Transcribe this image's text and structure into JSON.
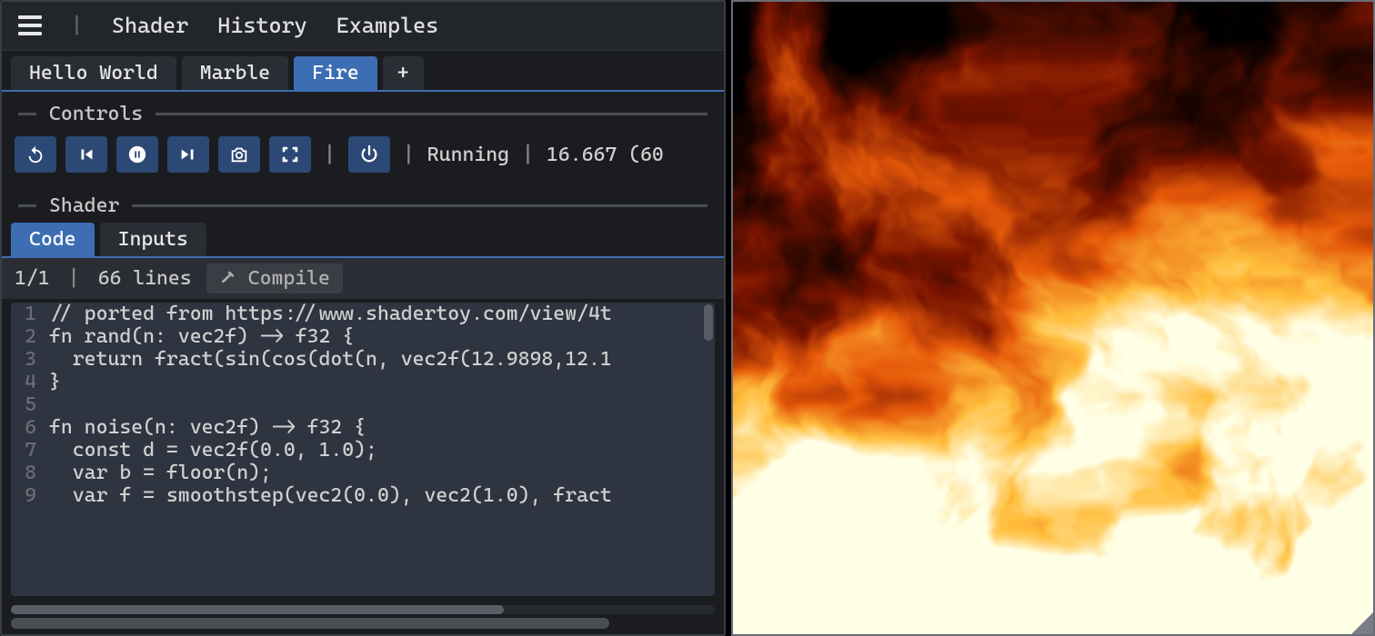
{
  "menubar": {
    "items": [
      "Shader",
      "History",
      "Examples"
    ]
  },
  "tabs": {
    "items": [
      {
        "label": "Hello World",
        "active": false
      },
      {
        "label": "Marble",
        "active": false
      },
      {
        "label": "Fire",
        "active": true
      }
    ],
    "add_label": "+"
  },
  "sections": {
    "controls": "Controls",
    "shader": "Shader"
  },
  "controls": {
    "status": "Running",
    "frame_time": "16.667 (60"
  },
  "subtabs": {
    "items": [
      {
        "label": "Code",
        "active": true
      },
      {
        "label": "Inputs",
        "active": false
      }
    ]
  },
  "code_toolbar": {
    "page": "1/1",
    "lines": "66 lines",
    "compile": "Compile"
  },
  "code": {
    "lines": [
      "// ported from https://www.shadertoy.com/view/4t",
      "fn rand(n: vec2f) -> f32 {",
      "  return fract(sin(cos(dot(n, vec2f(12.9898,12.1",
      "}",
      "",
      "fn noise(n: vec2f) -> f32 {",
      "  const d = vec2f(0.0, 1.0);",
      "  var b = floor(n);",
      "  var f = smoothstep(vec2(0.0), vec2(1.0), fract"
    ]
  },
  "colors": {
    "accent": "#3d6db3",
    "panel_bg": "#1a1c20",
    "editor_bg": "#2e3440"
  }
}
